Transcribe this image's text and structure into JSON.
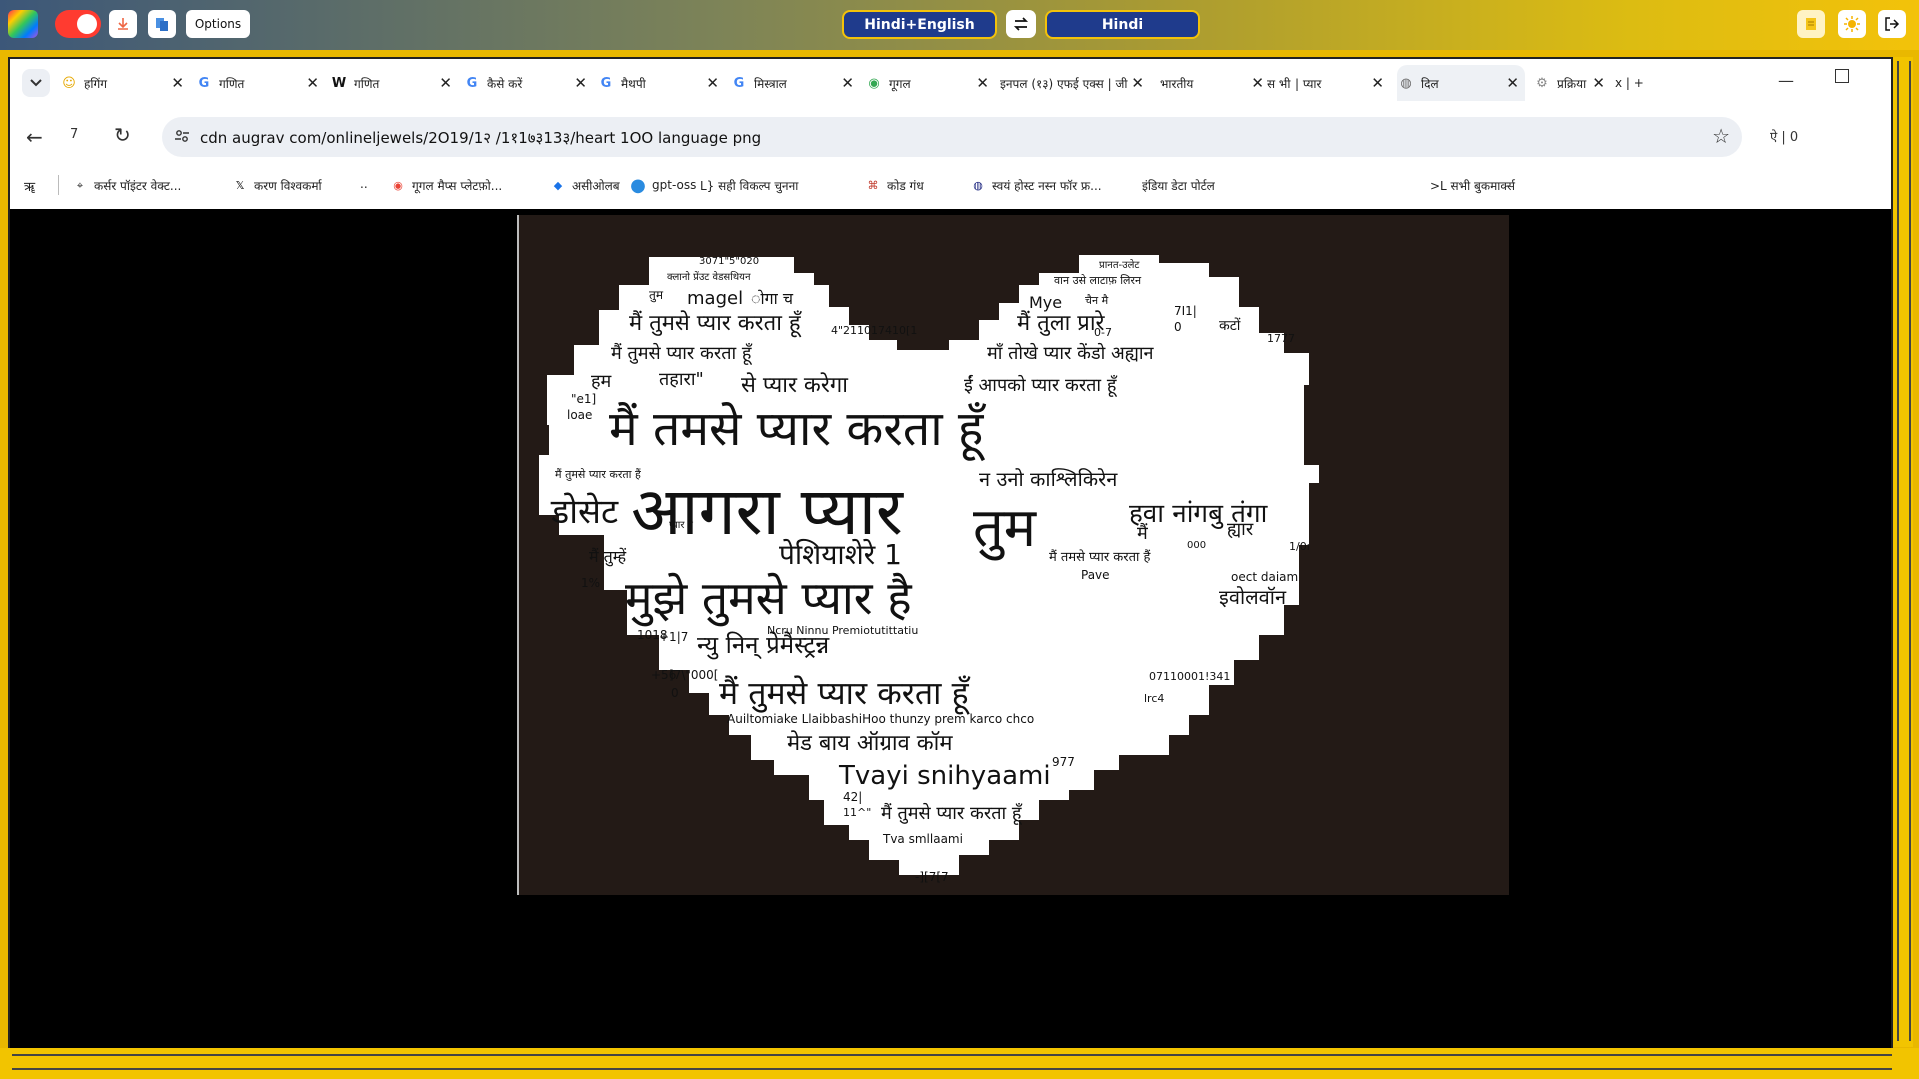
{
  "extension_bar": {
    "options_label": "Options",
    "source_lang": "Hindi+English",
    "target_lang": "Hindi",
    "swap_icon": "swap-arrows-icon"
  },
  "tabs": [
    {
      "label": "हगिंग",
      "icon": "emoji"
    },
    {
      "label": "गणित",
      "icon": "google"
    },
    {
      "label": "गणित",
      "icon": "wikipedia"
    },
    {
      "label": "कैसे करें",
      "icon": "google"
    },
    {
      "label": "मैथपी",
      "icon": "google"
    },
    {
      "label": "मिस्त्राल",
      "icon": "google"
    },
    {
      "label": "गूगल",
      "icon": "maps"
    },
    {
      "label": "इनपल (१३) एफई एक्स | जी",
      "icon": "none"
    },
    {
      "label": "भारतीय",
      "icon": "none"
    },
    {
      "label": "स भी",
      "icon": "none"
    },
    {
      "label": "| प्यार",
      "icon": "none"
    },
    {
      "label": "दिल",
      "icon": "globe",
      "active": true
    },
    {
      "label": "प्रक्रिया",
      "icon": "gear"
    },
    {
      "label": "x | +",
      "icon": "none"
    }
  ],
  "toolbar": {
    "back_count": "7",
    "url": "cdn augrav com/onlineljewels/2O19/1२ /1१1७३13३/heart 1OO language png",
    "profile_text": "ऐ | 0"
  },
  "bookmarks": [
    {
      "label": "कर्सर पॉइंटर वेक्ट...",
      "icon": "cursor"
    },
    {
      "label": "करण विश्वकर्मा",
      "icon": "x"
    },
    {
      "label": "..",
      "icon": "none"
    },
    {
      "label": "गूगल मैप्स प्लेटफ़ो...",
      "icon": "maps"
    },
    {
      "label": "असीओलब",
      "icon": "diamond"
    },
    {
      "label": "gpt-oss",
      "icon": "circle"
    },
    {
      "label": "L} सही विकल्प चुनना",
      "icon": "none"
    },
    {
      "label": "कोड गंध",
      "icon": "code"
    },
    {
      "label": "स्वयं होस्ट नस्न फॉर फ्र...",
      "icon": "globe"
    },
    {
      "label": "इंडिया डेटा पोर्टल",
      "icon": "none"
    },
    {
      "label": ">L सभी बुकमार्क्स",
      "icon": "none"
    }
  ],
  "bookmark_prefix": "ॠ",
  "heart_words": [
    {
      "text": "3071\"5\"020",
      "size": 10
    },
    {
      "text": "क्लानो प्रेंउट वेडसथियन",
      "size": 10
    },
    {
      "text": "तुम",
      "size": 12
    },
    {
      "text": "magel",
      "size": 18
    },
    {
      "text": "ोगा च",
      "size": 16
    },
    {
      "text": "मैं तुमसे प्यार करता हूँ",
      "size": 22
    },
    {
      "text": "4\"211017410[1",
      "size": 11
    },
    {
      "text": "मैं तुमसे प्यार करता हूँ",
      "size": 18
    },
    {
      "text": "हम",
      "size": 18
    },
    {
      "text": "तहारा\"",
      "size": 18
    },
    {
      "text": "से प्यार करेगा",
      "size": 22
    },
    {
      "text": "\"e1]",
      "size": 12
    },
    {
      "text": "loae",
      "size": 12
    },
    {
      "text": "मैं तमसे प्यार करता हूँ",
      "size": 48
    },
    {
      "text": "मैं तुमसे प्यार करता हैं",
      "size": 11
    },
    {
      "text": "डोसेट",
      "size": 34
    },
    {
      "text": "आगरा प्यार",
      "size": 66
    },
    {
      "text": "प्यार है",
      "size": 10
    },
    {
      "text": "पेशियाशेरे 1",
      "size": 28
    },
    {
      "text": "मैं तुम्हें",
      "size": 16
    },
    {
      "text": "1%",
      "size": 12
    },
    {
      "text": "मुझे तुमसे प्यार है",
      "size": 46
    },
    {
      "text": "1018",
      "size": 12
    },
    {
      "text": "+1|7",
      "size": 12
    },
    {
      "text": "न्यु निन् प्रेमैस्ट्रन्न",
      "size": 24
    },
    {
      "text": "+56",
      "size": 12
    },
    {
      "text": "]7\\\"000[",
      "size": 12
    },
    {
      "text": "0",
      "size": 12
    },
    {
      "text": "मैं तुमसे प्यार करता हूँ",
      "size": 32
    },
    {
      "text": "Auiltomiake LlaibbashiHoo thunzy prem karco chco",
      "size": 12
    },
    {
      "text": "मेड बाय ऑग्राव कॉम",
      "size": 22
    },
    {
      "text": "Tvayi snihyaami",
      "size": 26
    },
    {
      "text": "42|",
      "size": 12
    },
    {
      "text": "11^\"",
      "size": 11
    },
    {
      "text": "मैं तुमसे प्यार करता हूँ",
      "size": 18
    },
    {
      "text": "Tva smllaami",
      "size": 12
    },
    {
      "text": "-][7[7",
      "size": 12
    },
    {
      "text": "प्रानत-उलेट",
      "size": 10
    },
    {
      "text": "वान उसे लाटाफ़ लिरन",
      "size": 11
    },
    {
      "text": "Mye",
      "size": 16
    },
    {
      "text": "चैन मै",
      "size": 11
    },
    {
      "text": "7I1|",
      "size": 12
    },
    {
      "text": "मैं तुला प्रारे",
      "size": 22
    },
    {
      "text": "0-7",
      "size": 11
    },
    {
      "text": "0",
      "size": 12
    },
    {
      "text": "कटों",
      "size": 14
    },
    {
      "text": "1777",
      "size": 11
    },
    {
      "text": "माँ तोखे प्यार केंडो अह्यान",
      "size": 18
    },
    {
      "text": "ईं आपको प्यार करता हूँ",
      "size": 18
    },
    {
      "text": "न उनो काश्लिकिरेन",
      "size": 20
    },
    {
      "text": "तुम",
      "size": 54
    },
    {
      "text": "हवा नांगबु तंगा",
      "size": 26
    },
    {
      "text": "मैं",
      "size": 18
    },
    {
      "text": "ह्यार",
      "size": 18
    },
    {
      "text": "000",
      "size": 10
    },
    {
      "text": "ו1/0",
      "size": 11
    },
    {
      "text": "मैं तमसे प्यार करता हैं",
      "size": 13
    },
    {
      "text": "Pave",
      "size": 12
    },
    {
      "text": "oect daiam",
      "size": 12
    },
    {
      "text": "इवोलवॉन",
      "size": 20
    },
    {
      "text": "Ncru Ninnu Premiotutittatiu",
      "size": 11
    },
    {
      "text": "07110001!341",
      "size": 11
    },
    {
      "text": "lrc4",
      "size": 11
    },
    {
      "text": "977",
      "size": 12
    }
  ]
}
